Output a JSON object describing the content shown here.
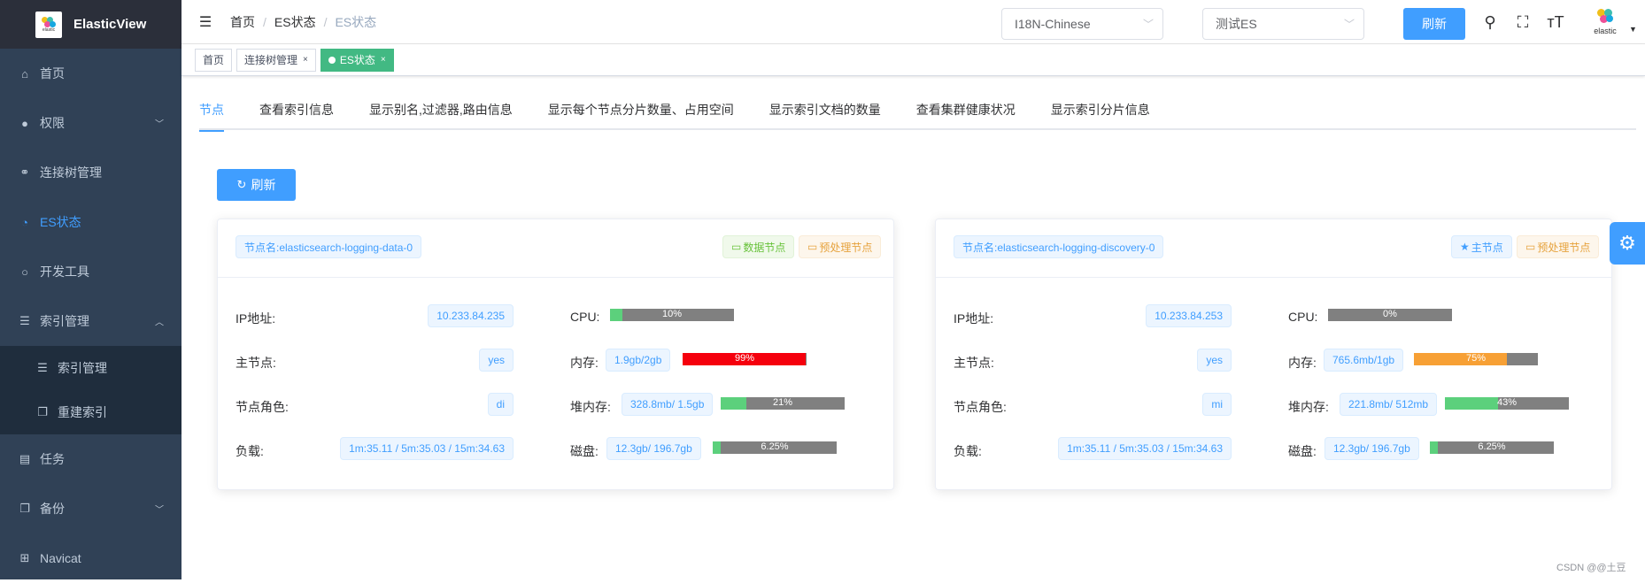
{
  "app": {
    "title": "ElasticView",
    "logo_text": "elastic"
  },
  "sidebar": {
    "items": [
      {
        "label": "首页",
        "icon": "home-icon"
      },
      {
        "label": "权限",
        "icon": "user-icon"
      },
      {
        "label": "连接树管理",
        "icon": "link-icon"
      },
      {
        "label": "ES状态",
        "icon": "chart-icon"
      },
      {
        "label": "开发工具",
        "icon": "search-icon"
      },
      {
        "label": "索引管理",
        "icon": "database-icon"
      },
      {
        "label": "索引管理",
        "icon": "database-icon"
      },
      {
        "label": "重建索引",
        "icon": "copy-icon"
      },
      {
        "label": "任务",
        "icon": "document-icon"
      },
      {
        "label": "备份",
        "icon": "copy-icon"
      },
      {
        "label": "Navicat",
        "icon": "plus-box-icon"
      }
    ]
  },
  "header": {
    "breadcrumb": [
      "首页",
      "ES状态",
      "ES状态"
    ],
    "language": "I18N-Chinese",
    "connection": "测试ES",
    "refresh": "刷新",
    "avatar_text": "elastic"
  },
  "tags": [
    {
      "label": "首页"
    },
    {
      "label": "连接树管理",
      "close": "×"
    },
    {
      "label": "ES状态",
      "close": "×"
    }
  ],
  "tabs": [
    "节点",
    "查看索引信息",
    "显示别名,过滤器,路由信息",
    "显示每个节点分片数量、占用空间",
    "显示索引文档的数量",
    "查看集群健康状况",
    "显示索引分片信息"
  ],
  "main": {
    "refresh_label": "刷新"
  },
  "labels": {
    "ip": "IP地址:",
    "master": "主节点:",
    "role": "节点角色:",
    "load": "负载:",
    "cpu": "CPU:",
    "mem": "内存:",
    "heap": "堆内存:",
    "disk": "磁盘:"
  },
  "nodes": [
    {
      "name": "节点名:elasticsearch-logging-data-0",
      "badges": [
        "数据节点",
        "预处理节点"
      ],
      "ip": "10.233.84.235",
      "master": "yes",
      "role": "di",
      "load": "1m:35.11 / 5m:35.03 / 15m:34.63",
      "cpu": {
        "pct": 0.1,
        "text": "10%",
        "color": "#5cd07c"
      },
      "mem": {
        "value": "1.9gb/2gb",
        "pct": 0.99,
        "text": "99%",
        "color": "#f5000d"
      },
      "heap": {
        "value": "328.8mb/ 1.5gb",
        "pct": 0.21,
        "text": "21%",
        "color": "#5cd07c"
      },
      "disk": {
        "value": "12.3gb/ 196.7gb",
        "pct": 0.0625,
        "text": "6.25%",
        "color": "#5cd07c"
      }
    },
    {
      "name": "节点名:elasticsearch-logging-discovery-0",
      "badges": [
        "主节点",
        "预处理节点"
      ],
      "ip": "10.233.84.253",
      "master": "yes",
      "role": "mi",
      "load": "1m:35.11 / 5m:35.03 / 15m:34.63",
      "cpu": {
        "pct": 0,
        "text": "0%",
        "color": "#5cd07c"
      },
      "mem": {
        "value": "765.6mb/1gb",
        "pct": 0.75,
        "text": "75%",
        "color": "#f7a035"
      },
      "heap": {
        "value": "221.8mb/ 512mb",
        "pct": 0.43,
        "text": "43%",
        "color": "#5cd07c"
      },
      "disk": {
        "value": "12.3gb/ 196.7gb",
        "pct": 0.0625,
        "text": "6.25%",
        "color": "#5cd07c"
      }
    }
  ],
  "watermark": "CSDN @@土豆"
}
